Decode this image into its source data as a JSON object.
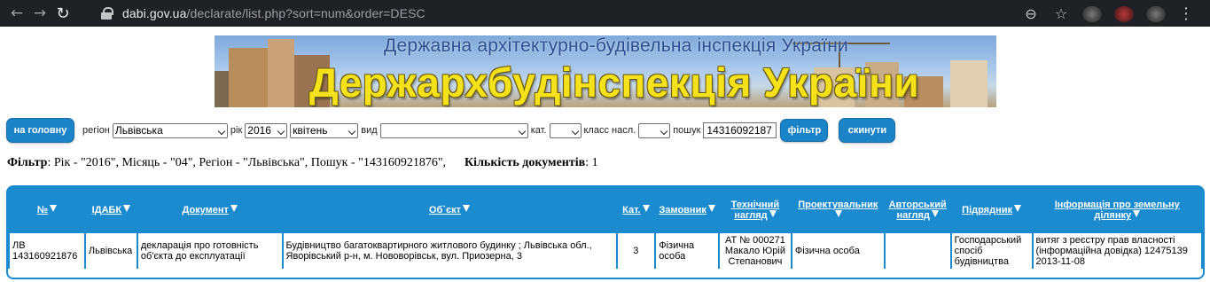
{
  "browser": {
    "url_host": "dabi.gov.ua",
    "url_path": "/declarate/list.php?sort=num&order=DESC"
  },
  "banner": {
    "top_title": "Державна архітектурно-будівельна інспекція України",
    "main_title": "Держархбудінспекція України"
  },
  "toolbar": {
    "home_button": "на головну",
    "region_label": "регіон",
    "region_value": "Львівська",
    "year_label": "рік",
    "year_value": "2016",
    "month_value": "квітень",
    "type_label": "вид",
    "type_value": "",
    "category_label": "кат.",
    "category_value": "",
    "class_label": "класс насл.",
    "class_value": "",
    "search_label": "пошук",
    "search_value": "14316092187",
    "filter_button": "фільтр",
    "reset_button": "скинути"
  },
  "summary": {
    "filter_label": "Фільтр",
    "filter_text": ": Рік - \"2016\", Місяць - \"04\", Регіон - \"Львівська\", Пошук - \"143160921876\",",
    "count_label": "Кількість документів",
    "count_value": ": 1"
  },
  "table": {
    "headers": {
      "num": "№",
      "idabk": "ІДАБК",
      "document": "Документ",
      "object": "Об`єкт",
      "category": "Кат.",
      "customer": "Замовник",
      "tech_supervision_1": "Технічний",
      "tech_supervision_2": "нагляд",
      "designer": "Проектувальник",
      "author_supervision_1": "Авторський",
      "author_supervision_2": "нагляд",
      "contractor": "Підрядник",
      "land_info": "Інформація про земельну ділянку"
    },
    "rows": [
      {
        "num_1": "ЛВ",
        "num_2": "143160921876",
        "idabk": "Львівська",
        "document_1": "декларація про готовність",
        "document_2": "об'єкта до експлуатації",
        "object_1": "Будівництво багатоквартирного житлового будинку ; Львівська обл.,",
        "object_2": "Яворівський р-н, м. Нововорівськ, вул. Приозерна, 3",
        "category": "3",
        "customer_1": "Фізична",
        "customer_2": "особа",
        "tech_1": "АТ № 000271",
        "tech_2": "Макало Юрій",
        "tech_3": "Степанович",
        "designer": "Фізична особа",
        "author": "",
        "contractor_1": "Господарський",
        "contractor_2": "спосіб",
        "contractor_3": "будівництва",
        "land_1": "витяг з реєстру прав власності",
        "land_2": "(інформаційна довідка) 12475139",
        "land_3": "2013-11-08"
      }
    ]
  }
}
